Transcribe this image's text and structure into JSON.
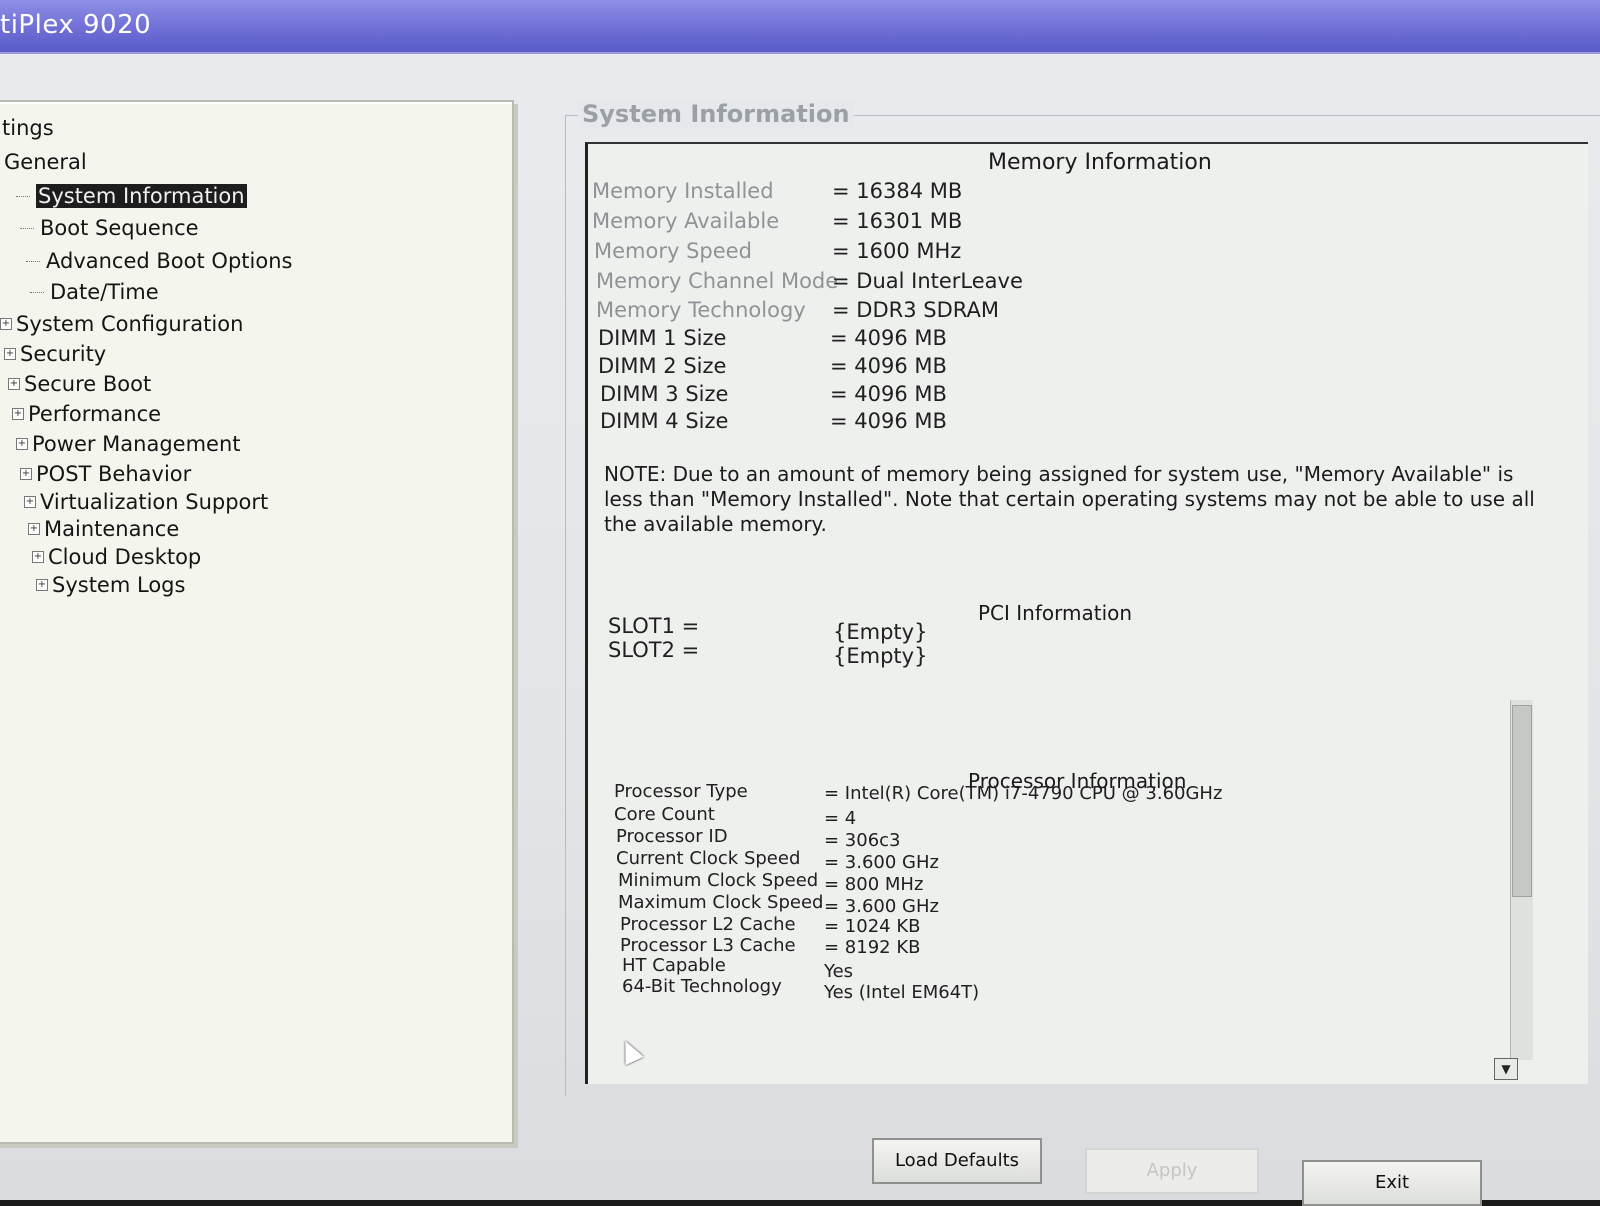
{
  "window": {
    "title": "tiPlex 9020"
  },
  "tree": {
    "root_label": "tings",
    "items": [
      {
        "label": "General",
        "level": 0
      },
      {
        "label": "System Information",
        "level": 1,
        "selected": true
      },
      {
        "label": "Boot Sequence",
        "level": 1
      },
      {
        "label": "Advanced Boot Options",
        "level": 1
      },
      {
        "label": "Date/Time",
        "level": 1
      },
      {
        "label": "System Configuration",
        "level": 0
      },
      {
        "label": "Security",
        "level": 0
      },
      {
        "label": "Secure Boot",
        "level": 0
      },
      {
        "label": "Performance",
        "level": 0
      },
      {
        "label": "Power Management",
        "level": 0
      },
      {
        "label": "POST Behavior",
        "level": 0
      },
      {
        "label": "Virtualization Support",
        "level": 0
      },
      {
        "label": "Maintenance",
        "level": 0
      },
      {
        "label": "Cloud Desktop",
        "level": 0
      },
      {
        "label": "System Logs",
        "level": 0
      }
    ]
  },
  "panel": {
    "group_title": "System Information",
    "memory": {
      "title": "Memory Information",
      "rows": [
        {
          "key": "Memory Installed",
          "value": "= 16384 MB"
        },
        {
          "key": "Memory Available",
          "value": "= 16301 MB"
        },
        {
          "key": "Memory Speed",
          "value": "= 1600 MHz"
        },
        {
          "key": "Memory Channel Mode",
          "value": "= Dual InterLeave"
        },
        {
          "key": "Memory Technology",
          "value": "= DDR3 SDRAM"
        },
        {
          "key": "DIMM 1 Size",
          "value": "= 4096 MB"
        },
        {
          "key": "DIMM 2 Size",
          "value": "= 4096 MB"
        },
        {
          "key": "DIMM 3 Size",
          "value": "= 4096 MB"
        },
        {
          "key": "DIMM 4 Size",
          "value": "= 4096 MB"
        }
      ],
      "note": "NOTE: Due to an amount of memory being assigned for system use, \"Memory Available\" is less than \"Memory Installed\". Note that certain operating systems may not be able to use all the available memory."
    },
    "pci": {
      "title": "PCI Information",
      "rows": [
        {
          "key": "SLOT1 =",
          "value": "{Empty}"
        },
        {
          "key": "SLOT2 =",
          "value": "{Empty}"
        }
      ]
    },
    "processor": {
      "title": "Processor Information",
      "rows": [
        {
          "key": "Processor Type",
          "value": "= Intel(R) Core(TM) i7-4790 CPU @ 3.60GHz"
        },
        {
          "key": "Core Count",
          "value": "= 4"
        },
        {
          "key": "Processor ID",
          "value": "= 306c3"
        },
        {
          "key": "Current Clock Speed",
          "value": "= 3.600 GHz"
        },
        {
          "key": "Minimum Clock Speed",
          "value": "= 800 MHz"
        },
        {
          "key": "Maximum Clock Speed",
          "value": "= 3.600 GHz"
        },
        {
          "key": "Processor L2 Cache",
          "value": "= 1024 KB"
        },
        {
          "key": "Processor L3 Cache",
          "value": "= 8192 KB"
        },
        {
          "key": "HT Capable",
          "value": "Yes"
        },
        {
          "key": "64-Bit Technology",
          "value": "Yes (Intel EM64T)"
        }
      ]
    }
  },
  "buttons": {
    "load_defaults": "Load Defaults",
    "apply": "Apply",
    "exit": "Exit"
  },
  "icons": {
    "expander": "plus-box-icon",
    "scroll_down": "arrow-down-icon",
    "cursor": "mouse-pointer-icon"
  }
}
